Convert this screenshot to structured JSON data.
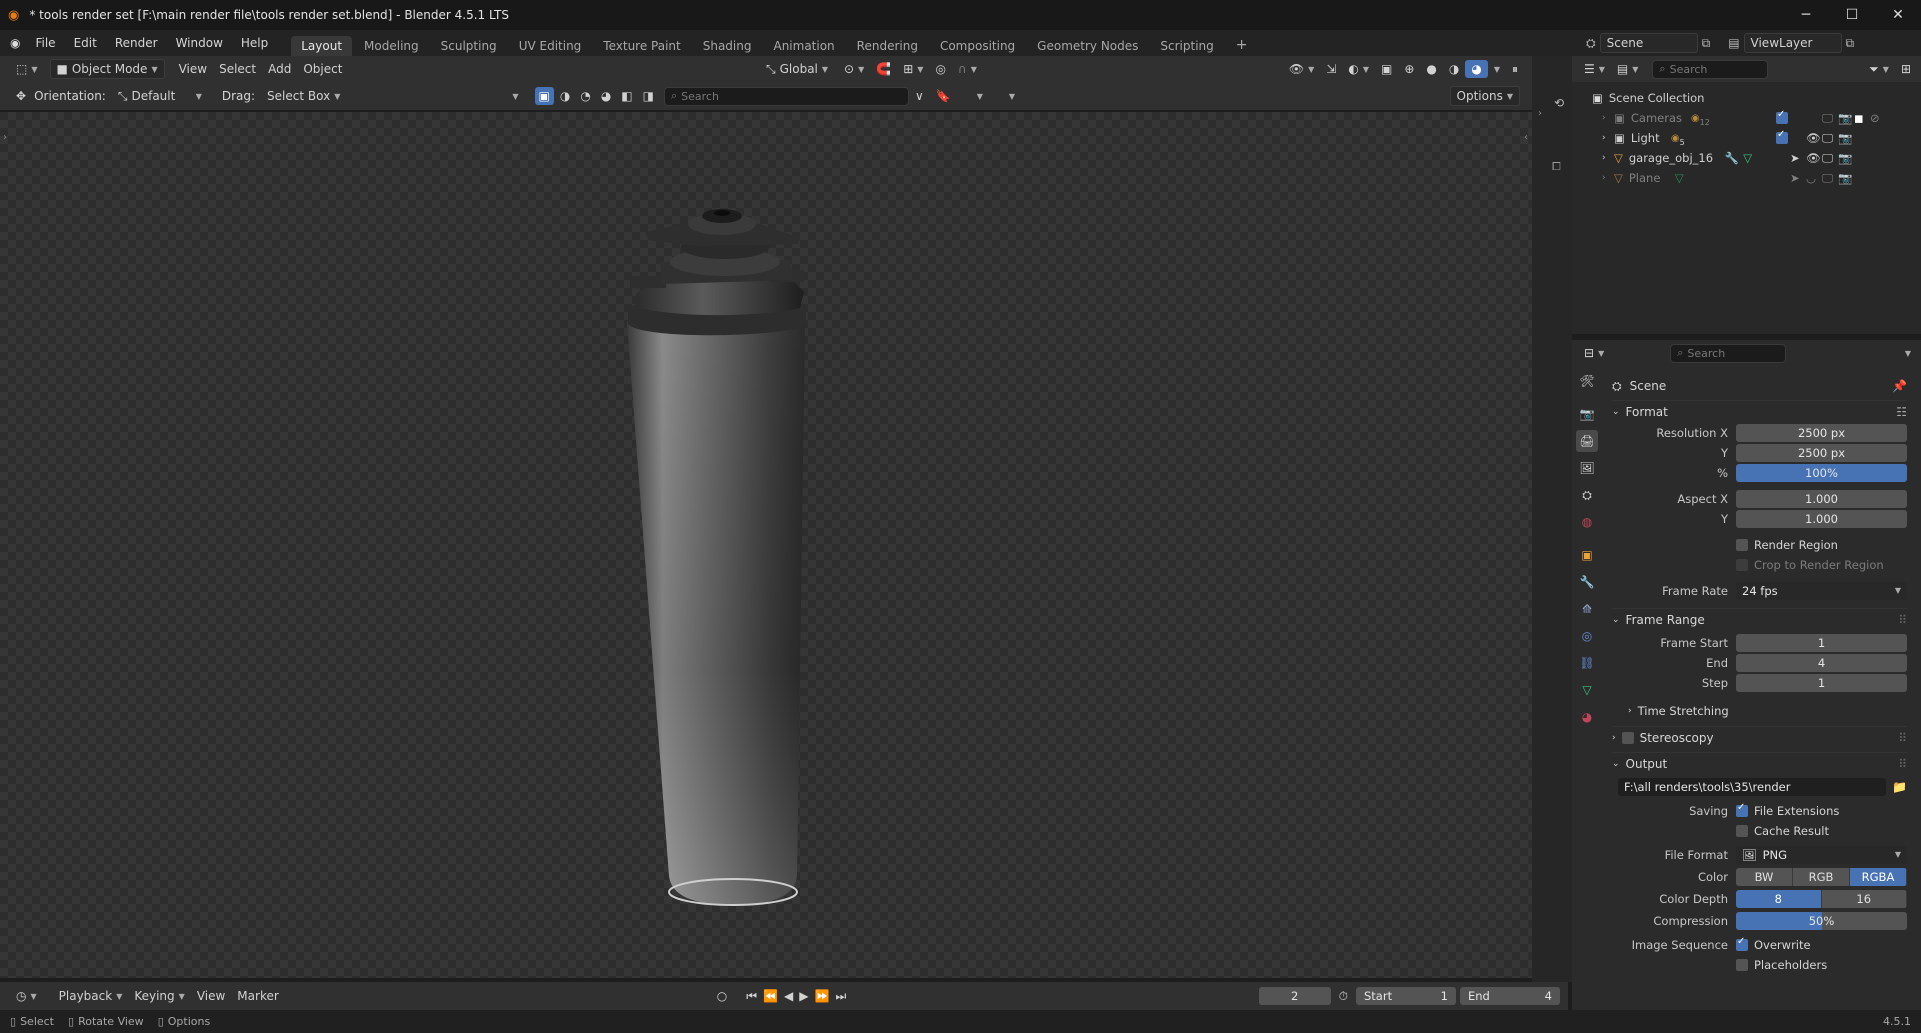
{
  "window": {
    "title": "* tools render set [F:\\main render file\\tools render set.blend] - Blender 4.5.1 LTS",
    "minimize": "─",
    "maximize": "☐",
    "close": "✕"
  },
  "menu": [
    "File",
    "Edit",
    "Render",
    "Window",
    "Help"
  ],
  "workspaces": [
    "Layout",
    "Modeling",
    "Sculpting",
    "UV Editing",
    "Texture Paint",
    "Shading",
    "Animation",
    "Rendering",
    "Compositing",
    "Geometry Nodes",
    "Scripting"
  ],
  "active_workspace": "Layout",
  "scene_name": "Scene",
  "view_layer": "ViewLayer",
  "viewport_header": {
    "mode": "Object Mode",
    "menus": [
      "View",
      "Select",
      "Add",
      "Object"
    ],
    "transform": "Global"
  },
  "tool_header": {
    "orientation_label": "Orientation:",
    "orientation_value": "Default",
    "drag_label": "Drag:",
    "drag_value": "Select Box",
    "search_placeholder": "Search",
    "options": "Options"
  },
  "outliner": {
    "search_placeholder": "Search",
    "root": "Scene Collection",
    "items": [
      {
        "name": "Cameras",
        "badge": "12",
        "dim": true
      },
      {
        "name": "Light",
        "badge": "5",
        "dim": false
      },
      {
        "name": "garage_obj_16",
        "badge": "",
        "dim": false
      },
      {
        "name": "Plane",
        "badge": "",
        "dim": true
      }
    ]
  },
  "properties": {
    "search_placeholder": "Search",
    "context": "Scene",
    "format": {
      "title": "Format",
      "resolution_x_label": "Resolution X",
      "resolution_x": "2500 px",
      "y_label": "Y",
      "resolution_y": "2500 px",
      "percent_label": "%",
      "percent": "100%",
      "aspect_x_label": "Aspect X",
      "aspect_x": "1.000",
      "aspect_y_label": "Y",
      "aspect_y": "1.000",
      "render_region": "Render Region",
      "crop_region": "Crop to Render Region",
      "frame_rate_label": "Frame Rate",
      "frame_rate": "24 fps"
    },
    "frame_range": {
      "title": "Frame Range",
      "start_label": "Frame Start",
      "start": "1",
      "end_label": "End",
      "end": "4",
      "step_label": "Step",
      "step": "1",
      "time_stretching": "Time Stretching"
    },
    "stereoscopy": "Stereoscopy",
    "output": {
      "title": "Output",
      "path": "F:\\all renders\\tools\\35\\render",
      "saving_label": "Saving",
      "file_extensions": "File Extensions",
      "cache_result": "Cache Result",
      "file_format_label": "File Format",
      "file_format": "PNG",
      "color_label": "Color",
      "color_options": [
        "BW",
        "RGB",
        "RGBA"
      ],
      "color_selected": "RGBA",
      "color_depth_label": "Color Depth",
      "depth_options": [
        "8",
        "16"
      ],
      "depth_selected": "8",
      "compression_label": "Compression",
      "compression": "50%",
      "compression_value": 0.5,
      "image_sequence_label": "Image Sequence",
      "overwrite": "Overwrite",
      "placeholders": "Placeholders"
    }
  },
  "timeline": {
    "menus": [
      "Playback",
      "Keying",
      "View",
      "Marker"
    ],
    "current_frame": "2",
    "start_label": "Start",
    "start": "1",
    "end_label": "End",
    "end": "4"
  },
  "statusbar": {
    "select": "Select",
    "rotate": "Rotate View",
    "options": "Options",
    "version": "4.5.1"
  },
  "colors": {
    "accent": "#4772b3",
    "panel": "#2b2b2b",
    "header": "#303030"
  }
}
